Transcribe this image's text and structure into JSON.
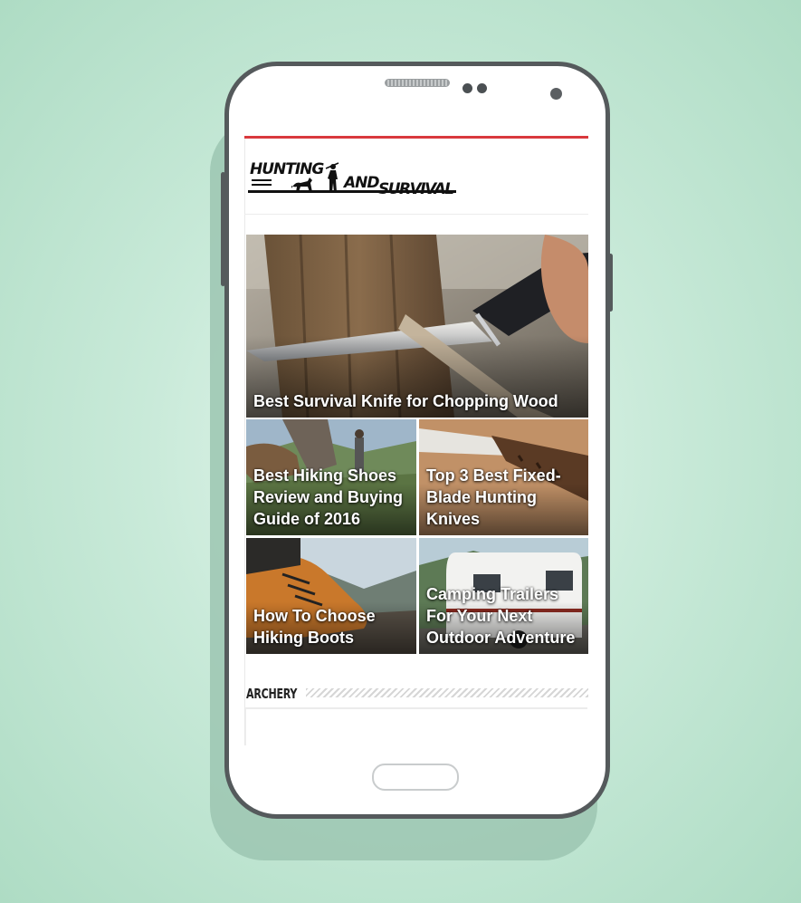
{
  "site": {
    "logo_text": "HUNTING AND SURVIVAL"
  },
  "featured": [
    {
      "title": "Best Survival Knife for Chopping Wood"
    },
    {
      "title": "Best Hiking Shoes Review and Buying Guide of 2016"
    },
    {
      "title": "Top 3 Best Fixed-Blade Hunting Knives"
    },
    {
      "title": "How To Choose Hiking Boots"
    },
    {
      "title": "Camping Trailers For Your Next Outdoor Adventure"
    }
  ],
  "section": {
    "label": "ARCHERY"
  },
  "colors": {
    "accent_bar": "#d9393d",
    "background": "#b1dcc6",
    "phone_frame": "#555a5c"
  }
}
